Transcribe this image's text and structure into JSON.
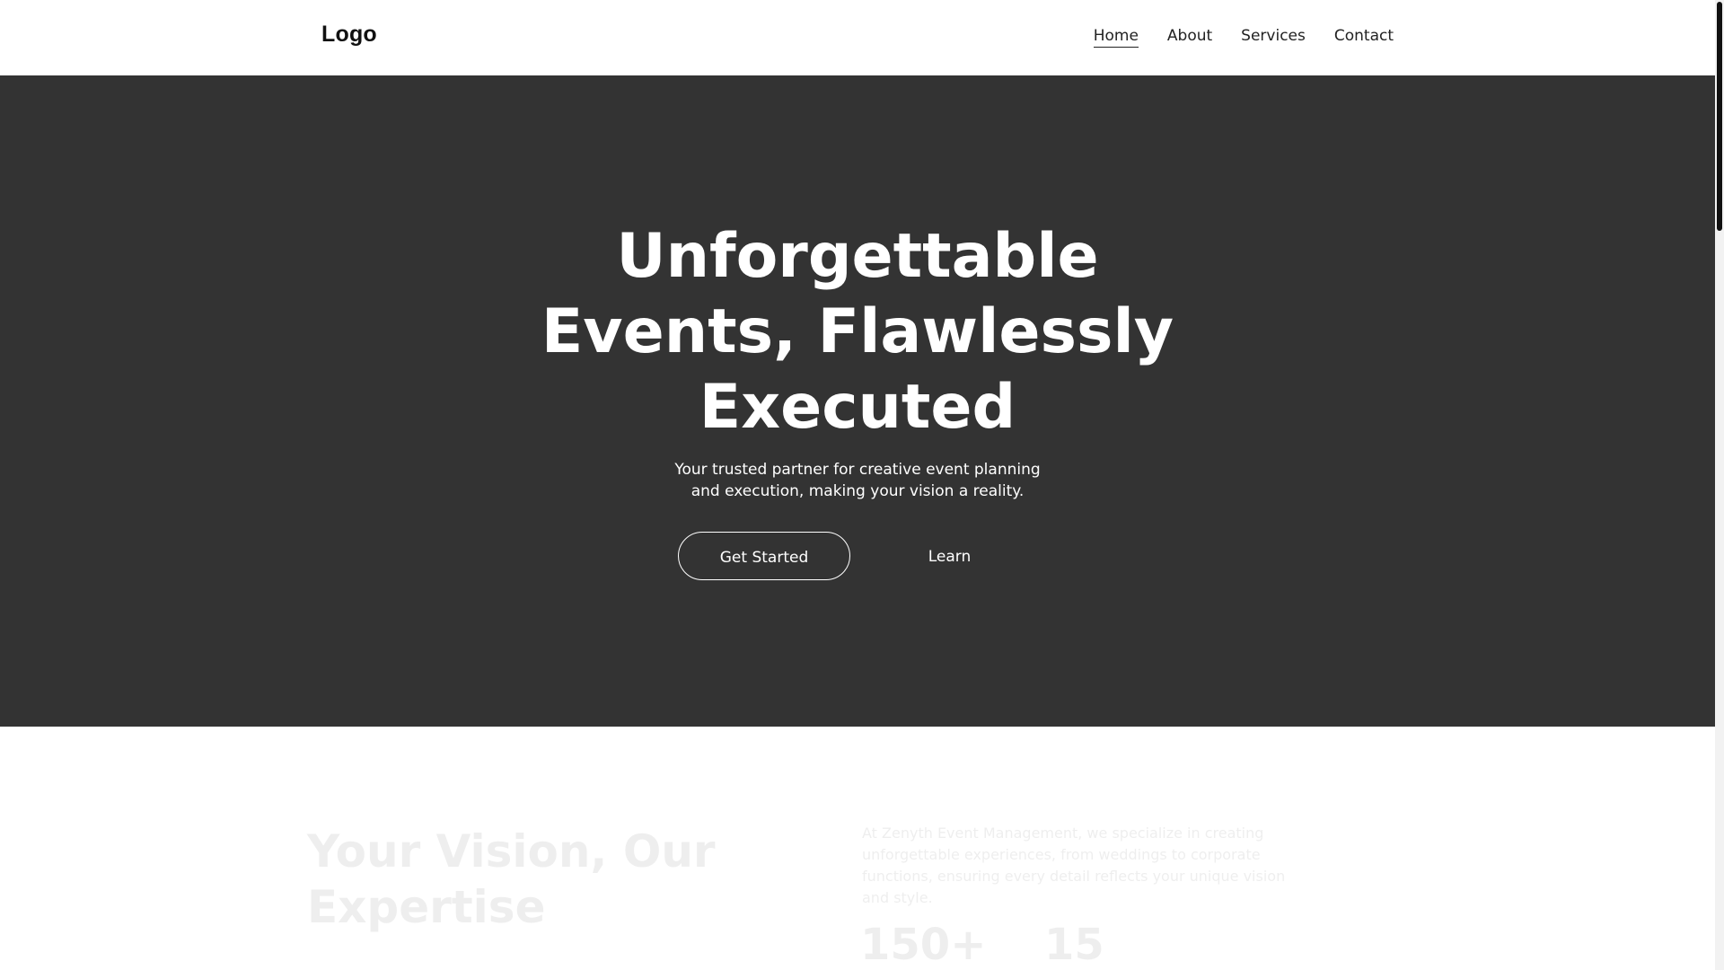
{
  "header": {
    "logo": "Logo",
    "nav": [
      {
        "label": "Home",
        "active": true
      },
      {
        "label": "About",
        "active": false
      },
      {
        "label": "Services",
        "active": false
      },
      {
        "label": "Contact",
        "active": false
      }
    ]
  },
  "hero": {
    "title_lines": [
      "Unforgettable",
      "Events, Flawlessly",
      "Executed"
    ],
    "subtitle": "Your trusted partner for creative event planning and execution, making your vision a reality.",
    "primary_button": "Get Started",
    "secondary_button": "Learn"
  },
  "section_two": {
    "title_lines": [
      "Your Vision, Our",
      "Expertise"
    ],
    "text": "At Zenyth Event Management, we specialize in creating unforgettable experiences, from weddings to corporate functions, ensuring every detail reflects your unique vision and style.",
    "stats": [
      {
        "value": "150+"
      },
      {
        "value": "15"
      }
    ]
  },
  "colors": {
    "hero_background": "#333333",
    "header_background": "#ffffff",
    "text_dark": "#111111",
    "text_light": "#ffffff"
  }
}
